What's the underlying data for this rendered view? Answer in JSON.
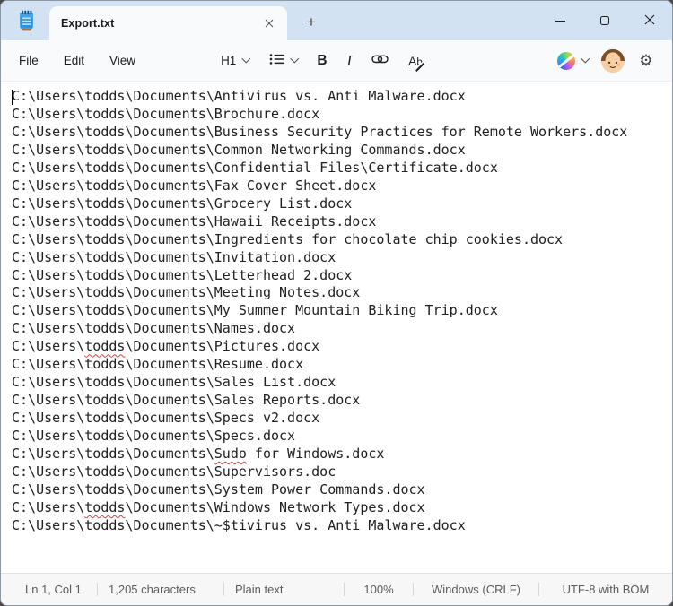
{
  "app": {
    "name": "Notepad"
  },
  "colors": {
    "titlebar_bg": "#d3e2f2",
    "chrome_bg": "#f9fafb",
    "editor_bg": "#ffffff",
    "statusbar_bg": "#f7f7f8",
    "text": "#212121",
    "muted_text": "#5c5c5c",
    "squiggle_red": "#dd4040",
    "notepad_icon_blue": "#2e93dd"
  },
  "titlebar": {
    "tab_title": "Export.txt",
    "new_tab_glyph": "+"
  },
  "menu": {
    "items": [
      {
        "label": "File"
      },
      {
        "label": "Edit"
      },
      {
        "label": "View"
      }
    ]
  },
  "toolbar": {
    "heading_label": "H1",
    "bold_label": "B",
    "italic_label": "I",
    "clear_format_a": "A",
    "clear_format_b": "b",
    "gear_glyph": "⚙"
  },
  "editor": {
    "caret": {
      "line": 1,
      "col": 1
    },
    "lines": [
      [
        {
          "t": "C:\\Users\\todds\\Documents\\Antivirus vs. Anti Malware.docx"
        }
      ],
      [
        {
          "t": "C:\\Users\\todds\\Documents\\Brochure.docx"
        }
      ],
      [
        {
          "t": "C:\\Users\\todds\\Documents\\Business Security Practices for Remote Workers.docx"
        }
      ],
      [
        {
          "t": "C:\\Users\\todds\\Documents\\Common Networking Commands.docx"
        }
      ],
      [
        {
          "t": "C:\\Users\\todds\\Documents\\Confidential Files\\Certificate.docx"
        }
      ],
      [
        {
          "t": "C:\\Users\\todds\\Documents\\Fax Cover Sheet.docx"
        }
      ],
      [
        {
          "t": "C:\\Users\\todds\\Documents\\Grocery List.docx"
        }
      ],
      [
        {
          "t": "C:\\Users\\todds\\Documents\\Hawaii Receipts.docx"
        }
      ],
      [
        {
          "t": "C:\\Users\\todds\\Documents\\Ingredients for chocolate chip cookies.docx"
        }
      ],
      [
        {
          "t": "C:\\Users\\todds\\Documents\\Invitation.docx"
        }
      ],
      [
        {
          "t": "C:\\Users\\todds\\Documents\\Letterhead 2.docx"
        }
      ],
      [
        {
          "t": "C:\\Users\\todds\\Documents\\Meeting Notes.docx"
        }
      ],
      [
        {
          "t": "C:\\Users\\todds\\Documents\\My Summer Mountain Biking Trip.docx"
        }
      ],
      [
        {
          "t": "C:\\Users\\todds\\Documents\\Names.docx"
        }
      ],
      [
        {
          "t": "C:\\Users\\"
        },
        {
          "t": "todds",
          "err": true
        },
        {
          "t": "\\Documents\\Pictures.docx"
        }
      ],
      [
        {
          "t": "C:\\Users\\todds\\Documents\\Resume.docx"
        }
      ],
      [
        {
          "t": "C:\\Users\\todds\\Documents\\Sales List.docx"
        }
      ],
      [
        {
          "t": "C:\\Users\\todds\\Documents\\Sales Reports.docx"
        }
      ],
      [
        {
          "t": "C:\\Users\\todds\\Documents\\Specs v2.docx"
        }
      ],
      [
        {
          "t": "C:\\Users\\todds\\Documents\\Specs.docx"
        }
      ],
      [
        {
          "t": "C:\\Users\\todds\\Documents\\"
        },
        {
          "t": "Sudo",
          "err": true
        },
        {
          "t": " for Windows.docx"
        }
      ],
      [
        {
          "t": "C:\\Users\\todds\\Documents\\Supervisors.doc"
        }
      ],
      [
        {
          "t": "C:\\Users\\todds\\Documents\\System Power Commands.docx"
        }
      ],
      [
        {
          "t": "C:\\Users\\"
        },
        {
          "t": "todds",
          "err": true
        },
        {
          "t": "\\Documents\\Windows Network Types.docx"
        }
      ],
      [
        {
          "t": "C:\\Users\\todds\\Documents\\~$tivirus vs. Anti Malware.docx"
        }
      ]
    ]
  },
  "statusbar": {
    "position": "Ln 1, Col 1",
    "characters": "1,205 characters",
    "format": "Plain text",
    "zoom": "100%",
    "line_ending": "Windows (CRLF)",
    "encoding": "UTF-8 with BOM"
  }
}
